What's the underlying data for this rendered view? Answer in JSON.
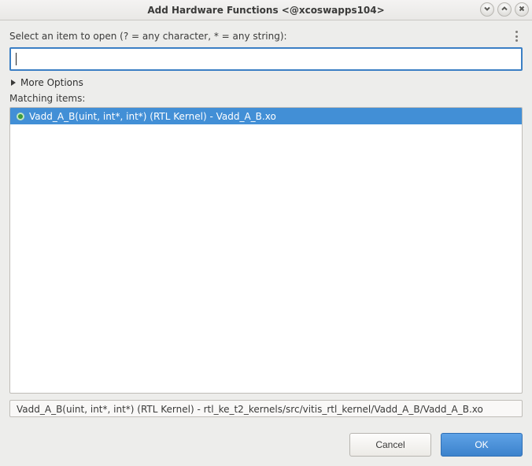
{
  "window": {
    "title": "Add Hardware Functions  <@xcoswapps104>"
  },
  "controls": {
    "minimize_tip": "Minimize",
    "maximize_tip": "Maximize",
    "close_tip": "Close"
  },
  "main": {
    "select_label": "Select an item to open (? = any character, * = any string):",
    "filter_value": "",
    "more_options_label": "More Options",
    "matching_label": "Matching items:"
  },
  "list": {
    "items": [
      {
        "label": "Vadd_A_B(uint, int*, int*) (RTL Kernel) - Vadd_A_B.xo",
        "selected": true
      }
    ]
  },
  "path": {
    "text": "Vadd_A_B(uint, int*, int*) (RTL Kernel) - rtl_ke_t2_kernels/src/vitis_rtl_kernel/Vadd_A_B/Vadd_A_B.xo"
  },
  "buttons": {
    "cancel": "Cancel",
    "ok": "OK"
  }
}
